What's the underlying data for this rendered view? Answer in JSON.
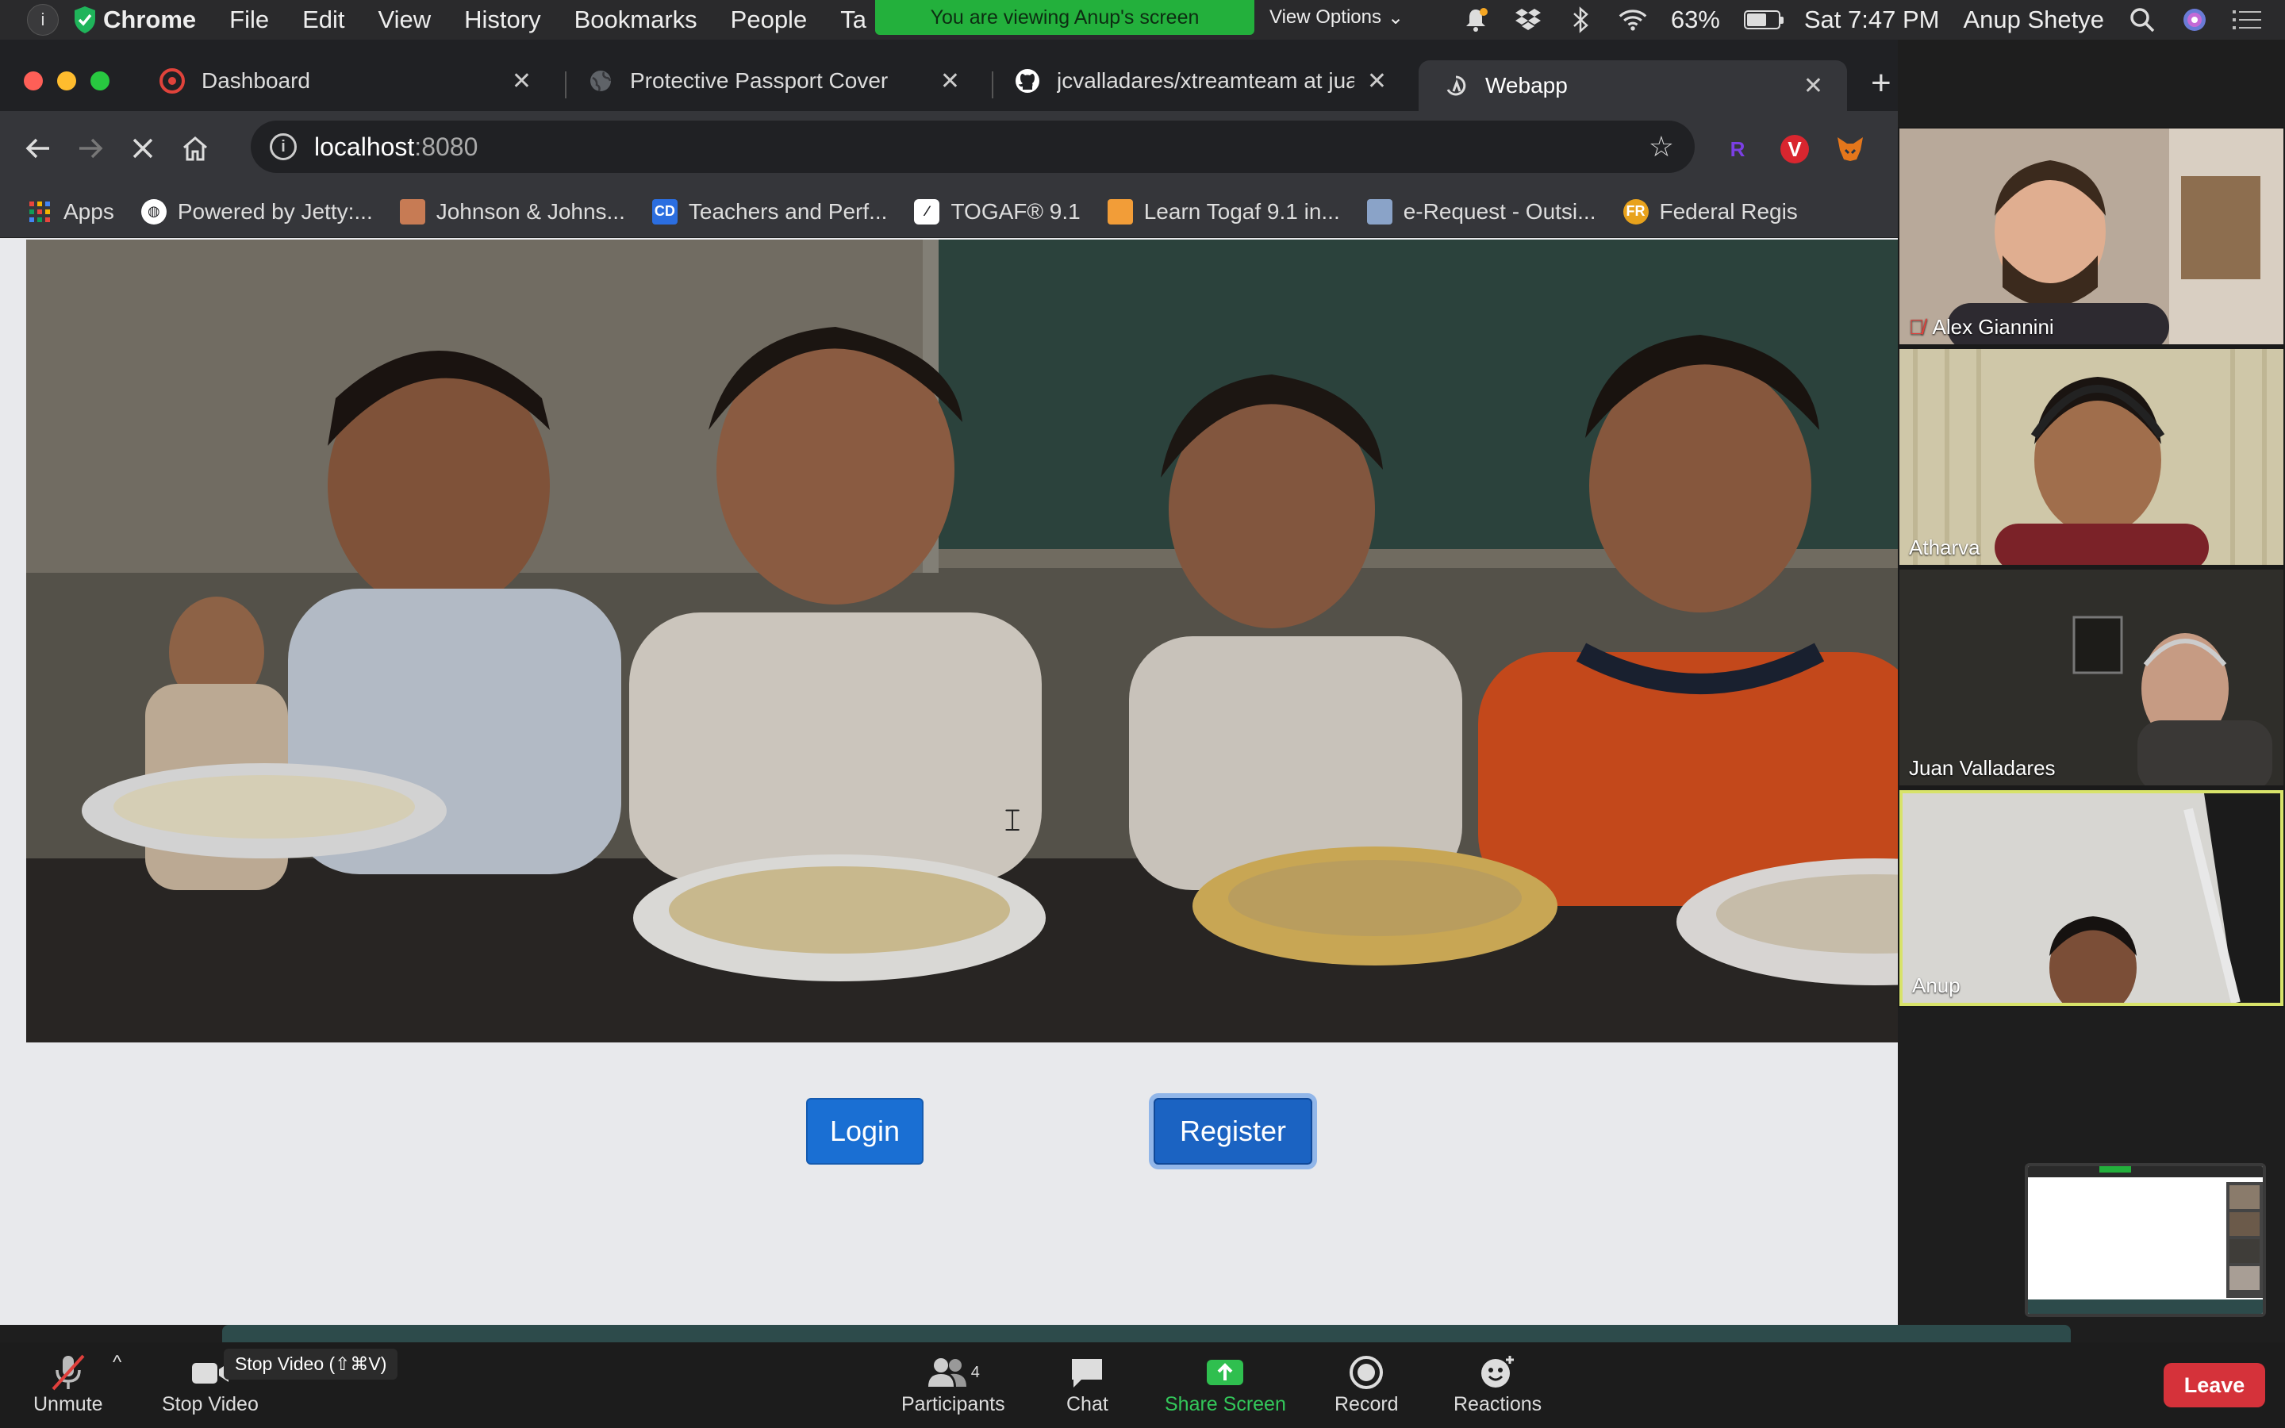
{
  "menubar": {
    "app_name": "Chrome",
    "menus": [
      "File",
      "Edit",
      "View",
      "History",
      "Bookmarks",
      "People",
      "Ta"
    ],
    "share_banner": "You are viewing Anup's screen",
    "view_options": "View Options",
    "battery": "63%",
    "battery_level": 0.63,
    "clock": "Sat 7:47 PM",
    "user": "Anup Shetye"
  },
  "chrome": {
    "tabs": [
      {
        "title": "Dashboard",
        "icon": "dashboard-favicon"
      },
      {
        "title": "Protective Passport Cover",
        "icon": "globe-favicon"
      },
      {
        "title": "jcvalladares/xtreamteam at jua",
        "icon": "github-favicon"
      },
      {
        "title": "Webapp",
        "icon": "webapp-favicon"
      }
    ],
    "url_host": "localhost",
    "url_port": ":8080",
    "bookmarks": [
      {
        "label": "Apps"
      },
      {
        "label": "Powered by Jetty:..."
      },
      {
        "label": "Johnson & Johns..."
      },
      {
        "label": "Teachers and Perf..."
      },
      {
        "label": "TOGAF® 9.1"
      },
      {
        "label": "Learn Togaf 9.1 in..."
      },
      {
        "label": "e-Request - Outsi..."
      },
      {
        "label": "Federal Regis"
      }
    ],
    "extensions": [
      {
        "label": "R",
        "color": "#7b3fe4"
      },
      {
        "label": "V",
        "color": "#d9262f"
      }
    ]
  },
  "page": {
    "login_label": "Login",
    "register_label": "Register"
  },
  "participants": [
    {
      "name": "Alex Giannini",
      "muted": true
    },
    {
      "name": "Atharva",
      "muted": false
    },
    {
      "name": "Juan Valladares",
      "muted": false
    },
    {
      "name": "Anup",
      "muted": false
    }
  ],
  "zoom": {
    "unmute": "Unmute",
    "stop_video": "Stop Video",
    "stop_video_tooltip": "Stop Video (⇧⌘V)",
    "participants_label": "Participants",
    "participants_count": "4",
    "chat": "Chat",
    "share_screen": "Share Screen",
    "record": "Record",
    "reactions": "Reactions",
    "leave": "Leave"
  },
  "colors": {
    "share_banner": "#23b03c",
    "primary_button": "#1a6fd3",
    "leave": "#d5323a",
    "active_speaker": "#d8e36a"
  }
}
